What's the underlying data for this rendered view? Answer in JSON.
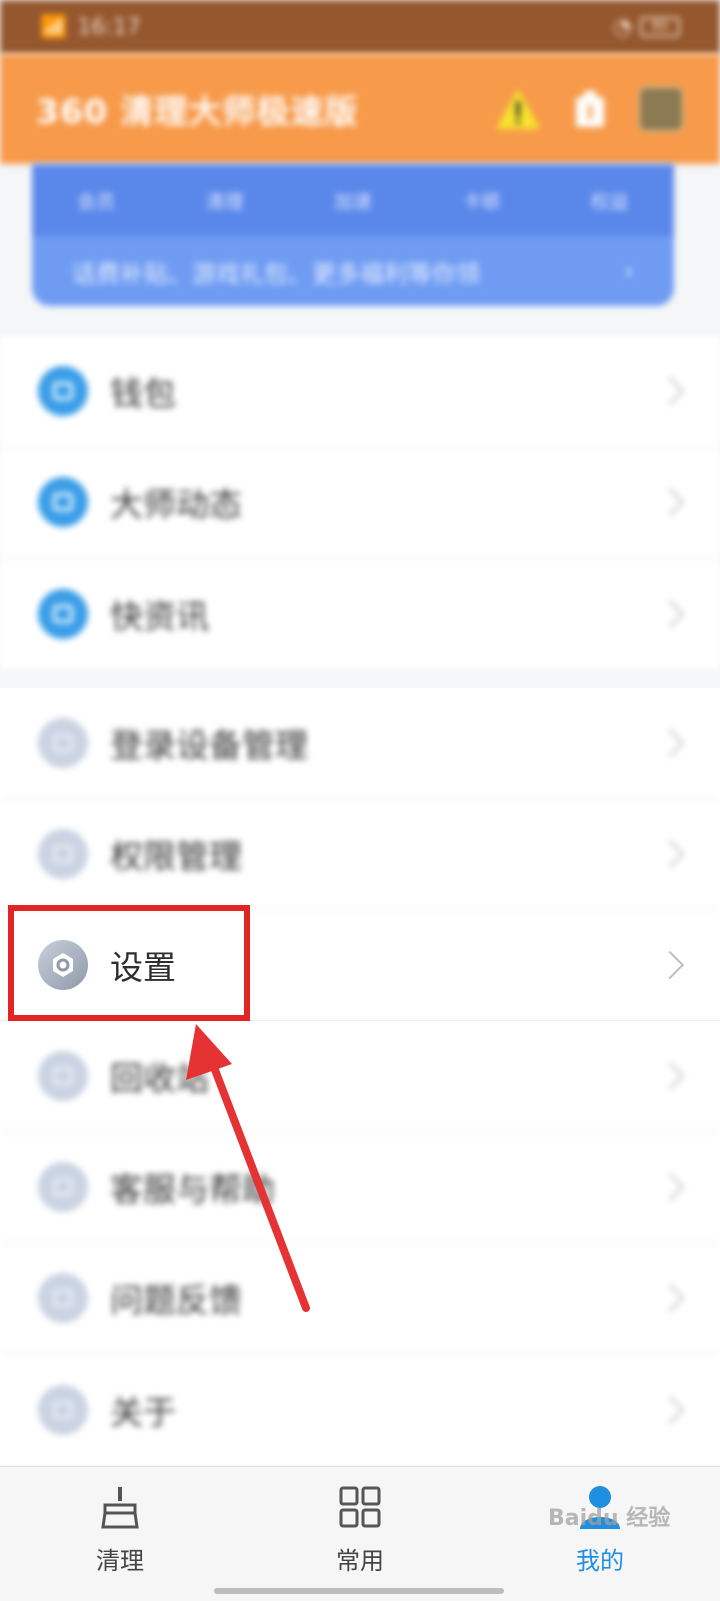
{
  "status_bar": {
    "time": "16:17",
    "battery": "80"
  },
  "header": {
    "title": "360 清理大师极速版"
  },
  "vip_card": {
    "tabs": [
      "会员",
      "清理",
      "加速",
      "卡顿",
      "权益"
    ],
    "promo": "话费补贴、游戏礼包、更多福利等你领",
    "chevron": "›"
  },
  "menu": {
    "group1": [
      {
        "label": "钱包",
        "icon": "wallet-icon"
      },
      {
        "label": "大师动态",
        "icon": "news-icon"
      },
      {
        "label": "快资讯",
        "icon": "info-icon"
      }
    ],
    "group2": [
      {
        "label": "登录设备管理",
        "icon": "device-icon"
      },
      {
        "label": "权限管理",
        "icon": "permission-icon"
      },
      {
        "label": "设置",
        "icon": "gear-icon"
      },
      {
        "label": "回收站",
        "icon": "recycle-bin-icon"
      },
      {
        "label": "客服与帮助",
        "icon": "help-icon"
      },
      {
        "label": "问题反馈",
        "icon": "feedback-icon"
      },
      {
        "label": "关于",
        "icon": "about-icon"
      }
    ]
  },
  "bottom_nav": {
    "items": [
      {
        "label": "清理",
        "icon": "broom-icon"
      },
      {
        "label": "常用",
        "icon": "grid-icon"
      },
      {
        "label": "我的",
        "icon": "user-icon"
      }
    ],
    "active_index": 2
  },
  "watermark": "Baidu 经验",
  "colors": {
    "header": "#f79a4a",
    "status_bar": "#94572e",
    "vip_card": "#6f9cf2",
    "highlight": "#e32424",
    "active_nav": "#1f8fe0"
  }
}
